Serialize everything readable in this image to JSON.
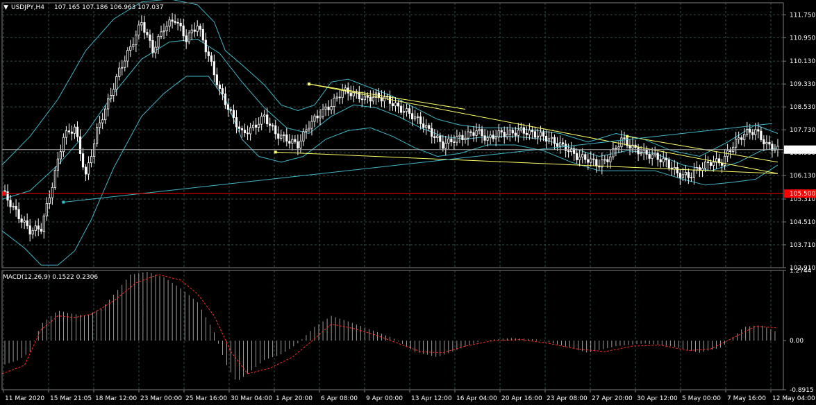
{
  "header": {
    "symbol": "USDJPY,H4",
    "ohlc": "107.165 107.186 106.963 107.037",
    "menu_icon": "triangle-down-icon"
  },
  "macd_header": "MACD(12,26,9) 0.1522 0.2306",
  "colors": {
    "background": "#000000",
    "grid": "#2f4f4f",
    "bull": "#ffffff",
    "bear": "#ffffff",
    "band": "#3fb8c8",
    "trendline_yellow": "#ffff66",
    "trendline_cyan": "#3fb8c8",
    "horizontal_red": "#ff0000",
    "signal": "#ff2a2a",
    "price_line": "#a9a9a9"
  },
  "chart_data": [
    {
      "type": "candlestick",
      "symbol": "USDJPY",
      "timeframe": "H4",
      "ylim": [
        102.91,
        112.17
      ],
      "y_ticks": [
        "111.750",
        "110.950",
        "110.130",
        "109.330",
        "108.530",
        "107.730",
        "106.930",
        "106.130",
        "105.310",
        "104.510",
        "103.710",
        "102.910"
      ],
      "x_ticks": [
        "11 Mar 2020",
        "15 Mar 21:05",
        "18 Mar 12:00",
        "23 Mar 00:00",
        "25 Mar 16:00",
        "30 Mar 04:00",
        "1 Apr 20:00",
        "6 Apr 08:00",
        "9 Apr 00:00",
        "13 Apr 12:00",
        "16 Apr 04:00",
        "20 Apr 16:00",
        "23 Apr 08:00",
        "27 Apr 20:00",
        "30 Apr 12:00",
        "5 May 00:00",
        "7 May 16:00",
        "12 May 04:00"
      ],
      "current_price": "107.037",
      "horizontal_level": "105.500",
      "close_path": [
        [
          0,
          105.6
        ],
        [
          6,
          104.7
        ],
        [
          10,
          104.2
        ],
        [
          14,
          104.3
        ],
        [
          18,
          105.8
        ],
        [
          22,
          107.5
        ],
        [
          26,
          107.8
        ],
        [
          30,
          106.1
        ],
        [
          34,
          107.7
        ],
        [
          38,
          108.7
        ],
        [
          42,
          109.8
        ],
        [
          46,
          110.6
        ],
        [
          50,
          111.5
        ],
        [
          54,
          110.5
        ],
        [
          58,
          111.3
        ],
        [
          62,
          111.6
        ],
        [
          66,
          110.9
        ],
        [
          70,
          111.4
        ],
        [
          74,
          110.3
        ],
        [
          78,
          109.1
        ],
        [
          82,
          108.3
        ],
        [
          86,
          107.6
        ],
        [
          90,
          107.8
        ],
        [
          94,
          108.2
        ],
        [
          98,
          107.6
        ],
        [
          102,
          107.4
        ],
        [
          106,
          107.2
        ],
        [
          110,
          107.9
        ],
        [
          114,
          108.3
        ],
        [
          118,
          108.6
        ],
        [
          122,
          109.1
        ],
        [
          126,
          109.0
        ],
        [
          130,
          108.8
        ],
        [
          134,
          108.9
        ],
        [
          138,
          108.8
        ],
        [
          142,
          108.5
        ],
        [
          146,
          108.3
        ],
        [
          150,
          108.0
        ],
        [
          154,
          107.6
        ],
        [
          158,
          107.2
        ],
        [
          162,
          107.4
        ],
        [
          166,
          107.5
        ],
        [
          170,
          107.7
        ],
        [
          174,
          107.4
        ],
        [
          178,
          107.6
        ],
        [
          182,
          107.6
        ],
        [
          186,
          107.7
        ],
        [
          190,
          107.6
        ],
        [
          194,
          107.5
        ],
        [
          198,
          107.3
        ],
        [
          202,
          107.1
        ],
        [
          206,
          106.8
        ],
        [
          210,
          106.7
        ],
        [
          214,
          106.5
        ],
        [
          218,
          106.8
        ],
        [
          222,
          107.4
        ],
        [
          226,
          107.1
        ],
        [
          230,
          106.9
        ],
        [
          234,
          106.8
        ],
        [
          238,
          106.6
        ],
        [
          242,
          106.2
        ],
        [
          246,
          106.1
        ],
        [
          250,
          106.4
        ],
        [
          254,
          106.6
        ],
        [
          258,
          106.6
        ],
        [
          262,
          107.2
        ],
        [
          266,
          107.6
        ],
        [
          270,
          107.7
        ],
        [
          274,
          107.2
        ],
        [
          278,
          107.037
        ]
      ],
      "bollinger_upper": [
        [
          0,
          106.5
        ],
        [
          10,
          107.5
        ],
        [
          20,
          108.8
        ],
        [
          30,
          110.5
        ],
        [
          40,
          111.6
        ],
        [
          50,
          112.2
        ],
        [
          60,
          112.3
        ],
        [
          70,
          112.1
        ],
        [
          76,
          111.5
        ],
        [
          80,
          110.5
        ],
        [
          86,
          110.0
        ],
        [
          94,
          109.3
        ],
        [
          100,
          108.6
        ],
        [
          106,
          108.4
        ],
        [
          112,
          108.6
        ],
        [
          118,
          109.4
        ],
        [
          124,
          109.5
        ],
        [
          132,
          109.2
        ],
        [
          140,
          108.9
        ],
        [
          148,
          108.5
        ],
        [
          156,
          108.1
        ],
        [
          164,
          107.9
        ],
        [
          172,
          107.8
        ],
        [
          182,
          107.8
        ],
        [
          192,
          107.7
        ],
        [
          200,
          107.6
        ],
        [
          210,
          107.3
        ],
        [
          220,
          107.6
        ],
        [
          230,
          107.4
        ],
        [
          240,
          107.0
        ],
        [
          250,
          106.8
        ],
        [
          260,
          107.3
        ],
        [
          270,
          107.9
        ],
        [
          278,
          107.6
        ]
      ],
      "bollinger_middle": [
        [
          0,
          105.3
        ],
        [
          10,
          105.6
        ],
        [
          20,
          106.5
        ],
        [
          30,
          107.6
        ],
        [
          40,
          109.0
        ],
        [
          50,
          110.2
        ],
        [
          60,
          110.8
        ],
        [
          70,
          110.9
        ],
        [
          78,
          110.4
        ],
        [
          86,
          109.4
        ],
        [
          94,
          108.5
        ],
        [
          102,
          107.8
        ],
        [
          110,
          107.6
        ],
        [
          118,
          108.2
        ],
        [
          126,
          108.6
        ],
        [
          134,
          108.5
        ],
        [
          142,
          108.2
        ],
        [
          150,
          107.8
        ],
        [
          158,
          107.5
        ],
        [
          166,
          107.4
        ],
        [
          174,
          107.5
        ],
        [
          184,
          107.5
        ],
        [
          194,
          107.4
        ],
        [
          204,
          107.1
        ],
        [
          214,
          106.8
        ],
        [
          224,
          107.0
        ],
        [
          234,
          106.9
        ],
        [
          244,
          106.5
        ],
        [
          254,
          106.3
        ],
        [
          264,
          106.6
        ],
        [
          272,
          107.0
        ],
        [
          278,
          107.1
        ]
      ],
      "bollinger_lower": [
        [
          0,
          104.2
        ],
        [
          8,
          103.6
        ],
        [
          14,
          103.0
        ],
        [
          20,
          103.0
        ],
        [
          26,
          103.5
        ],
        [
          32,
          104.6
        ],
        [
          40,
          106.4
        ],
        [
          50,
          108.2
        ],
        [
          58,
          109.0
        ],
        [
          66,
          109.6
        ],
        [
          74,
          109.6
        ],
        [
          80,
          108.8
        ],
        [
          86,
          107.4
        ],
        [
          92,
          106.8
        ],
        [
          100,
          106.6
        ],
        [
          108,
          106.8
        ],
        [
          116,
          107.4
        ],
        [
          124,
          107.7
        ],
        [
          132,
          107.8
        ],
        [
          140,
          107.5
        ],
        [
          148,
          107.1
        ],
        [
          156,
          106.8
        ],
        [
          164,
          106.9
        ],
        [
          174,
          107.2
        ],
        [
          184,
          107.2
        ],
        [
          194,
          107.0
        ],
        [
          204,
          106.6
        ],
        [
          214,
          106.3
        ],
        [
          224,
          106.3
        ],
        [
          234,
          106.3
        ],
        [
          244,
          106.0
        ],
        [
          252,
          105.8
        ],
        [
          262,
          105.9
        ],
        [
          270,
          106.0
        ],
        [
          278,
          106.5
        ]
      ],
      "trendlines": [
        {
          "color": "yellow",
          "from": [
            110,
            109.33
          ],
          "to": [
            278,
            106.2
          ]
        },
        {
          "color": "yellow",
          "from": [
            98,
            106.95
          ],
          "to": [
            278,
            106.2
          ]
        },
        {
          "color": "yellow",
          "from": [
            110,
            109.33
          ],
          "to": [
            166,
            108.45
          ]
        },
        {
          "color": "yellow",
          "from": [
            224,
            107.5
          ],
          "to": [
            278,
            106.6
          ]
        },
        {
          "color": "cyan",
          "from": [
            22,
            105.2
          ],
          "to": [
            276,
            107.95
          ]
        }
      ]
    },
    {
      "type": "bar",
      "name": "MACD(12,26,9)",
      "ylim": [
        -0.8915,
        1.2744
      ],
      "y_ticks": [
        "1.2744",
        "0.00",
        "-0.8915"
      ],
      "histogram": [
        [
          0,
          -0.45
        ],
        [
          6,
          -0.35
        ],
        [
          10,
          -0.2
        ],
        [
          14,
          0.3
        ],
        [
          20,
          0.55
        ],
        [
          24,
          0.5
        ],
        [
          30,
          0.45
        ],
        [
          36,
          0.6
        ],
        [
          42,
          0.95
        ],
        [
          46,
          1.2
        ],
        [
          52,
          1.25
        ],
        [
          58,
          1.15
        ],
        [
          64,
          0.95
        ],
        [
          70,
          0.7
        ],
        [
          76,
          0.15
        ],
        [
          80,
          -0.4
        ],
        [
          84,
          -0.75
        ],
        [
          88,
          -0.6
        ],
        [
          94,
          -0.35
        ],
        [
          100,
          -0.25
        ],
        [
          106,
          -0.05
        ],
        [
          112,
          0.25
        ],
        [
          118,
          0.45
        ],
        [
          124,
          0.35
        ],
        [
          132,
          0.2
        ],
        [
          140,
          0.05
        ],
        [
          148,
          -0.2
        ],
        [
          156,
          -0.3
        ],
        [
          164,
          -0.15
        ],
        [
          172,
          0.0
        ],
        [
          182,
          0.05
        ],
        [
          192,
          0.02
        ],
        [
          200,
          -0.08
        ],
        [
          210,
          -0.22
        ],
        [
          220,
          -0.1
        ],
        [
          230,
          -0.05
        ],
        [
          240,
          -0.1
        ],
        [
          250,
          -0.22
        ],
        [
          258,
          -0.12
        ],
        [
          266,
          0.25
        ],
        [
          272,
          0.28
        ],
        [
          278,
          0.15
        ]
      ],
      "signal": [
        [
          0,
          -0.6
        ],
        [
          8,
          -0.45
        ],
        [
          14,
          0.2
        ],
        [
          20,
          0.45
        ],
        [
          26,
          0.42
        ],
        [
          32,
          0.48
        ],
        [
          40,
          0.72
        ],
        [
          48,
          1.05
        ],
        [
          56,
          1.2
        ],
        [
          64,
          1.1
        ],
        [
          70,
          0.85
        ],
        [
          76,
          0.45
        ],
        [
          82,
          -0.2
        ],
        [
          88,
          -0.6
        ],
        [
          96,
          -0.5
        ],
        [
          104,
          -0.3
        ],
        [
          110,
          -0.05
        ],
        [
          118,
          0.3
        ],
        [
          126,
          0.22
        ],
        [
          134,
          0.1
        ],
        [
          142,
          -0.05
        ],
        [
          150,
          -0.2
        ],
        [
          158,
          -0.22
        ],
        [
          166,
          -0.1
        ],
        [
          176,
          0.0
        ],
        [
          186,
          0.02
        ],
        [
          196,
          -0.05
        ],
        [
          206,
          -0.15
        ],
        [
          216,
          -0.2
        ],
        [
          226,
          -0.1
        ],
        [
          236,
          -0.08
        ],
        [
          246,
          -0.18
        ],
        [
          254,
          -0.15
        ],
        [
          262,
          0.05
        ],
        [
          270,
          0.26
        ],
        [
          278,
          0.23
        ]
      ]
    }
  ]
}
